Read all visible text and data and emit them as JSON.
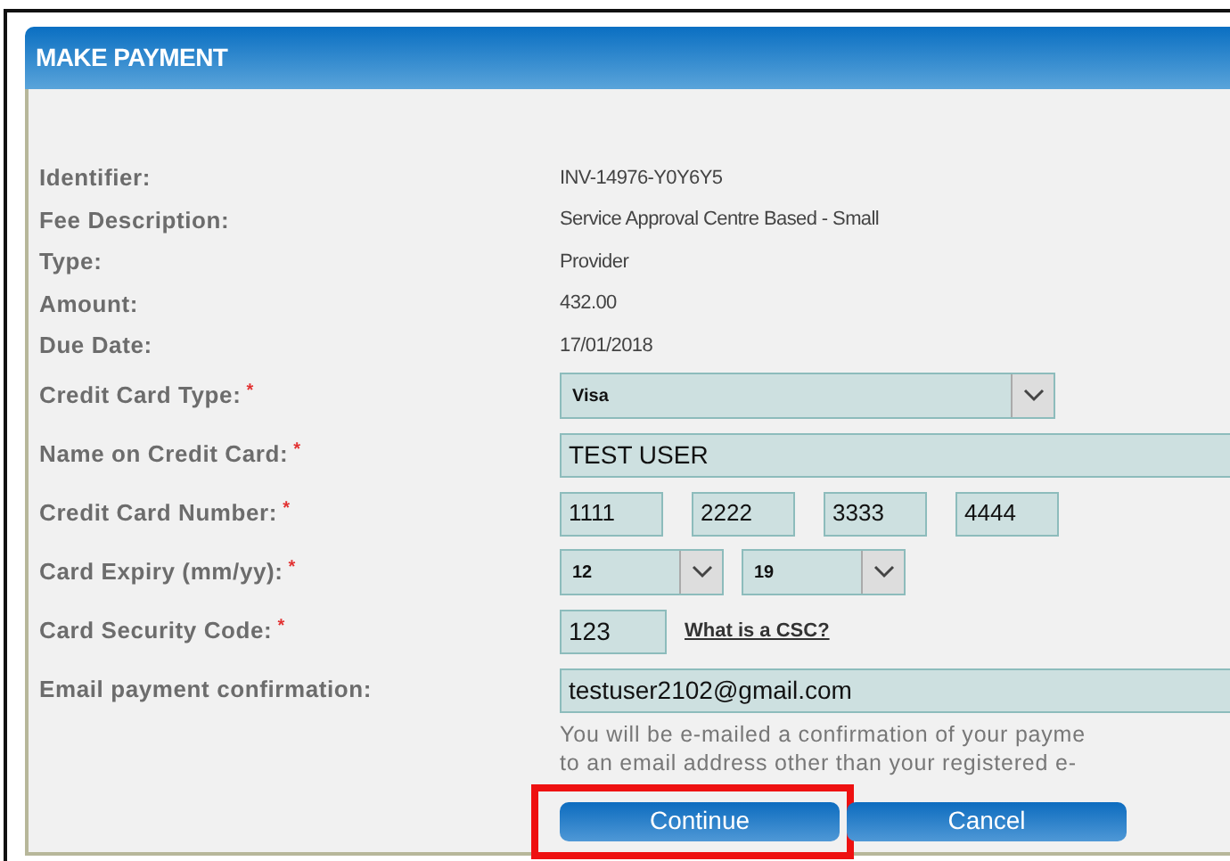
{
  "header": {
    "title": "MAKE PAYMENT"
  },
  "details": [
    {
      "label": "Identifier:",
      "value": "INV-14976-Y0Y6Y5"
    },
    {
      "label": "Fee Description:",
      "value": "Service Approval Centre Based - Small"
    },
    {
      "label": "Type:",
      "value": "Provider"
    },
    {
      "label": "Amount:",
      "value": "432.00"
    },
    {
      "label": "Due Date:",
      "value": "17/01/2018"
    }
  ],
  "fields": [
    {
      "kind": "select",
      "label": "Credit Card Type:",
      "required_mark": "*",
      "values": [
        "Visa"
      ]
    },
    {
      "kind": "wide",
      "label": "Name on Credit Card:",
      "required_mark": "*",
      "values": [
        "TEST USER"
      ]
    },
    {
      "kind": "split",
      "label": "Credit Card Number:",
      "required_mark": "*",
      "values": [
        "1111",
        "2222",
        "3333",
        "4444"
      ]
    },
    {
      "kind": "select-pair",
      "label": "Card Expiry (mm/yy):",
      "required_mark": "*",
      "values": [
        "12",
        "19"
      ]
    },
    {
      "kind": "short",
      "label": "Card Security Code:",
      "required_mark": "*",
      "values": [
        "123"
      ],
      "help_link": "What is a CSC?"
    },
    {
      "kind": "wide",
      "label": "Email payment confirmation:",
      "values": [
        "testuser2102@gmail.com"
      ],
      "note": [
        "You will be e-mailed a confirmation of your payme",
        "to an email address other than your registered e-"
      ]
    }
  ],
  "buttons": [
    {
      "label": "Continue",
      "highlighted": true
    },
    {
      "label": "Cancel",
      "highlighted": false
    }
  ]
}
